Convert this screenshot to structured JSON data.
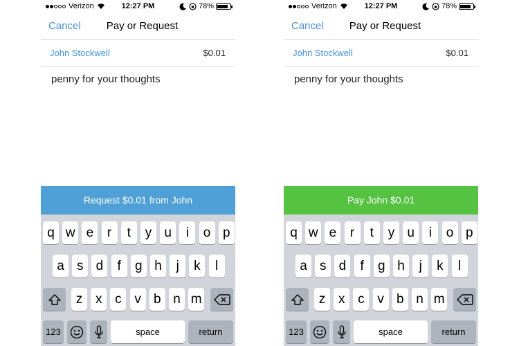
{
  "screens": [
    {
      "id": "left",
      "status": {
        "carrier": "Verizon",
        "time": "12:27 PM",
        "battery": "78%",
        "signal_bars": 2
      },
      "nav": {
        "cancel": "Cancel",
        "title": "Pay or Request"
      },
      "recipient": {
        "name": "John Stockwell",
        "amount": "$0.01"
      },
      "note": "penny for your thoughts",
      "action": {
        "label": "Request $0.01 from John",
        "color": "#4fa0d6"
      }
    },
    {
      "id": "right",
      "status": {
        "carrier": "Verizon",
        "time": "12:27 PM",
        "battery": "78%",
        "signal_bars": 2
      },
      "nav": {
        "cancel": "Cancel",
        "title": "Pay or Request"
      },
      "recipient": {
        "name": "John Stockwell",
        "amount": "$0.01"
      },
      "note": "penny for your thoughts",
      "action": {
        "label": "Pay John $0.01",
        "color": "#55c241"
      }
    }
  ],
  "keyboard": {
    "rows": [
      [
        "q",
        "w",
        "e",
        "r",
        "t",
        "y",
        "u",
        "i",
        "o",
        "p"
      ],
      [
        "a",
        "s",
        "d",
        "f",
        "g",
        "h",
        "j",
        "k",
        "l"
      ],
      [
        "z",
        "x",
        "c",
        "v",
        "b",
        "n",
        "m"
      ]
    ],
    "numbers_label": "123",
    "space_label": "space",
    "return_label": "return",
    "icons": {
      "shift": "shift-icon",
      "delete": "delete-icon",
      "emoji": "emoji-icon",
      "mic": "microphone-icon"
    }
  },
  "colors": {
    "link": "#3d8fd6",
    "keyboard_bg": "#d1d5db",
    "special_key": "#adb3bc"
  }
}
